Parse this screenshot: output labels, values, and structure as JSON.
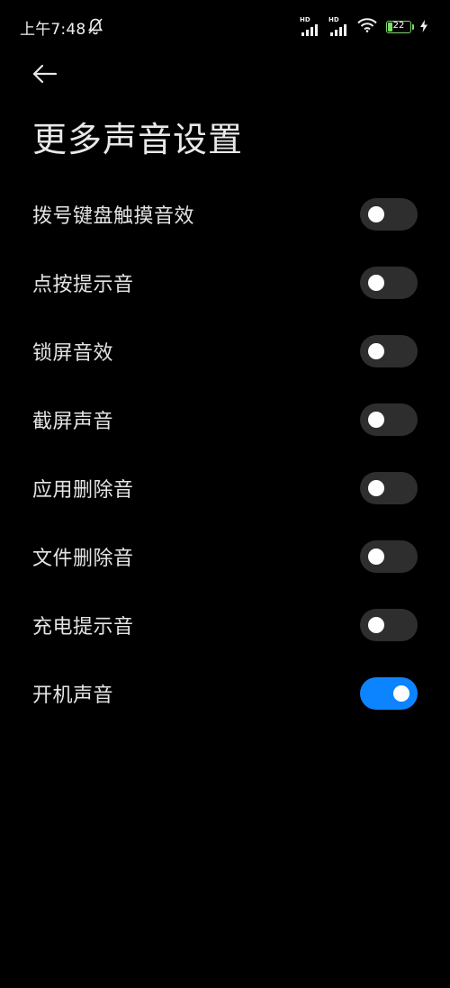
{
  "status_bar": {
    "time": "上午7:48",
    "signal_hd_1": "HD",
    "signal_hd_2": "HD",
    "battery_level": "22",
    "battery_fraction": 0.22,
    "icons": [
      "mute-bell-icon",
      "signal-icon",
      "signal-icon",
      "wifi-icon",
      "battery-icon",
      "charging-icon"
    ]
  },
  "header": {
    "back_icon": "back-arrow-icon",
    "title": "更多声音设置"
  },
  "settings": [
    {
      "label": "拨号键盘触摸音效",
      "enabled": false
    },
    {
      "label": "点按提示音",
      "enabled": false
    },
    {
      "label": "锁屏音效",
      "enabled": false
    },
    {
      "label": "截屏声音",
      "enabled": false
    },
    {
      "label": "应用删除音",
      "enabled": false
    },
    {
      "label": "文件删除音",
      "enabled": false
    },
    {
      "label": "充电提示音",
      "enabled": false
    },
    {
      "label": "开机声音",
      "enabled": true
    }
  ],
  "colors": {
    "background": "#000000",
    "toggle_off": "#2e2e2e",
    "toggle_on": "#0d84ff",
    "battery": "#7ddc6a"
  }
}
